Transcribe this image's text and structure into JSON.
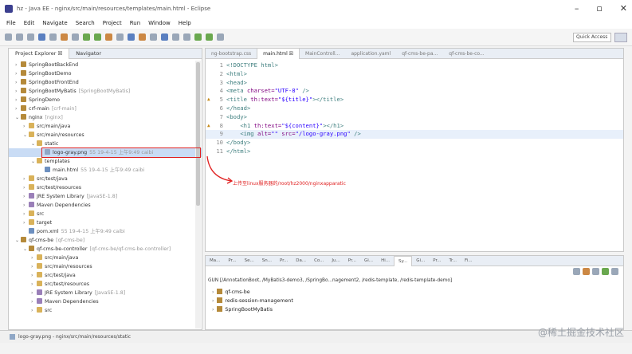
{
  "window": {
    "title": "hz - Java EE - nginx/src/main/resources/templates/main.html - Eclipse",
    "controls": [
      "–",
      "▫",
      "✕"
    ]
  },
  "menu": [
    "File",
    "Edit",
    "Navigate",
    "Search",
    "Project",
    "Run",
    "Window",
    "Help"
  ],
  "toolbar": {
    "quick_access": "Quick Access"
  },
  "left_panel": {
    "tabs": [
      "Project Explorer ☒",
      "Navigator"
    ],
    "tree": [
      {
        "indent": 0,
        "arrow": "›",
        "icon": "proj",
        "label": "SpringBootBackEnd",
        "sub": ""
      },
      {
        "indent": 0,
        "arrow": "›",
        "icon": "proj",
        "label": "SpringBootDemo",
        "sub": ""
      },
      {
        "indent": 0,
        "arrow": "›",
        "icon": "proj",
        "label": "SpringBootFrontEnd",
        "sub": ""
      },
      {
        "indent": 0,
        "arrow": "›",
        "icon": "proj",
        "label": "SpringBootMyBatis",
        "sub": "[SpringBootMyBatis]"
      },
      {
        "indent": 0,
        "arrow": "›",
        "icon": "proj",
        "label": "SpringDemo",
        "sub": ""
      },
      {
        "indent": 0,
        "arrow": "›",
        "icon": "proj",
        "label": "crf-main",
        "sub": "[crf-main]"
      },
      {
        "indent": 0,
        "arrow": "⌄",
        "icon": "proj",
        "label": "nginx",
        "sub": "[nginx]"
      },
      {
        "indent": 1,
        "arrow": "›",
        "icon": "pkg",
        "label": "src/main/java",
        "sub": ""
      },
      {
        "indent": 1,
        "arrow": "⌄",
        "icon": "pkg",
        "label": "src/main/resources",
        "sub": ""
      },
      {
        "indent": 2,
        "arrow": "⌄",
        "icon": "pkg",
        "label": "static",
        "sub": ""
      },
      {
        "indent": 3,
        "arrow": "",
        "icon": "file",
        "label": "logo-gray.png",
        "sub": "55 19-4-15 上午9:49 caibi",
        "selected": true
      },
      {
        "indent": 2,
        "arrow": "⌄",
        "icon": "pkg",
        "label": "templates",
        "sub": ""
      },
      {
        "indent": 3,
        "arrow": "",
        "icon": "xml",
        "label": "main.html",
        "sub": "55 19-4-15 上午9:49 caibi"
      },
      {
        "indent": 1,
        "arrow": "›",
        "icon": "pkg",
        "label": "src/test/java",
        "sub": ""
      },
      {
        "indent": 1,
        "arrow": "›",
        "icon": "pkg",
        "label": "src/test/resources",
        "sub": ""
      },
      {
        "indent": 1,
        "arrow": "›",
        "icon": "lib",
        "label": "JRE System Library",
        "sub": "[JavaSE-1.8]"
      },
      {
        "indent": 1,
        "arrow": "›",
        "icon": "lib",
        "label": "Maven Dependencies",
        "sub": ""
      },
      {
        "indent": 1,
        "arrow": "›",
        "icon": "pkg",
        "label": "src",
        "sub": ""
      },
      {
        "indent": 1,
        "arrow": "›",
        "icon": "pkg",
        "label": "target",
        "sub": ""
      },
      {
        "indent": 1,
        "arrow": "",
        "icon": "xml",
        "label": "pom.xml",
        "sub": "55 19-4-15 上午9:49 caibi"
      },
      {
        "indent": 0,
        "arrow": "⌄",
        "icon": "proj",
        "label": "qf-cms-be",
        "sub": "[qf-cms-be]"
      },
      {
        "indent": 1,
        "arrow": "⌄",
        "icon": "proj",
        "label": "qf-cms-be-controller",
        "sub": "[qf-cms-be/qf-cms-be-controller]"
      },
      {
        "indent": 2,
        "arrow": "›",
        "icon": "pkg",
        "label": "src/main/java",
        "sub": ""
      },
      {
        "indent": 2,
        "arrow": "›",
        "icon": "pkg",
        "label": "src/main/resources",
        "sub": ""
      },
      {
        "indent": 2,
        "arrow": "›",
        "icon": "pkg",
        "label": "src/test/java",
        "sub": ""
      },
      {
        "indent": 2,
        "arrow": "›",
        "icon": "pkg",
        "label": "src/test/resources",
        "sub": ""
      },
      {
        "indent": 2,
        "arrow": "›",
        "icon": "lib",
        "label": "JRE System Library",
        "sub": "[JavaSE-1.8]"
      },
      {
        "indent": 2,
        "arrow": "›",
        "icon": "lib",
        "label": "Maven Dependencies",
        "sub": ""
      },
      {
        "indent": 2,
        "arrow": "›",
        "icon": "pkg",
        "label": "src",
        "sub": ""
      }
    ]
  },
  "editor": {
    "tabs": [
      "ng-bootstrap.css",
      "main.html ☒",
      "MainControll...",
      "application.yaml",
      "qf-cms-be-pa...",
      "qf-cms-be-co..."
    ],
    "lines": [
      {
        "n": "1",
        "parts": [
          [
            "tag",
            "<!DOCTYPE html>"
          ]
        ]
      },
      {
        "n": "2",
        "parts": [
          [
            "tag",
            "<html>"
          ]
        ]
      },
      {
        "n": "3",
        "parts": [
          [
            "tag",
            "<head>"
          ]
        ]
      },
      {
        "n": "4",
        "parts": [
          [
            "tag",
            "<meta "
          ],
          [
            "attr",
            "charset="
          ],
          [
            "str",
            "\"UTF-8\""
          ],
          [
            "tag",
            " />"
          ]
        ]
      },
      {
        "n": "5",
        "marker": "▲",
        "parts": [
          [
            "tag",
            "<title "
          ],
          [
            "attr",
            "th:text="
          ],
          [
            "str",
            "\"${title}\""
          ],
          [
            "tag",
            "></title>"
          ]
        ]
      },
      {
        "n": "6",
        "parts": [
          [
            "tag",
            "</head>"
          ]
        ]
      },
      {
        "n": "7",
        "parts": [
          [
            "tag",
            "<body>"
          ]
        ]
      },
      {
        "n": "8",
        "marker": "▲",
        "parts": [
          [
            "txt",
            "    "
          ],
          [
            "tag",
            "<h1 "
          ],
          [
            "attr",
            "th:text="
          ],
          [
            "str",
            "\"${content}\""
          ],
          [
            "tag",
            "></h1>"
          ]
        ]
      },
      {
        "n": "9",
        "current": true,
        "parts": [
          [
            "txt",
            "    "
          ],
          [
            "tag",
            "<img "
          ],
          [
            "attr",
            "alt="
          ],
          [
            "str",
            "\"\""
          ],
          [
            "attr",
            " src="
          ],
          [
            "str",
            "\"/logo-gray.png\""
          ],
          [
            "tag",
            " />"
          ]
        ]
      },
      {
        "n": "10",
        "parts": [
          [
            "tag",
            "</body>"
          ]
        ]
      },
      {
        "n": "11",
        "parts": [
          [
            "tag",
            "</html>"
          ]
        ]
      }
    ]
  },
  "annotation": {
    "text": "上传至linux服务器的/root/hz2000/nginxapparatic"
  },
  "bottom_panel": {
    "tabs": [
      "Ma...",
      "Pr...",
      "Se...",
      "Sn...",
      "Pr...",
      "Da...",
      "Co...",
      "Ju...",
      "Pr...",
      "Gi...",
      "Hi...",
      "Sy...",
      "Gi...",
      "Pr...",
      "Tr...",
      "Fi..."
    ],
    "active_tab": "Sy...",
    "path": "GUN [/AnnotationBoot, /MyBatis3-demo3, /SpringBo...nagement2, /redis-template, /redis-template-demo]",
    "items": [
      "qf-cms-be",
      "redis-session-management",
      "SpringBootMyBatis"
    ]
  },
  "status": "logo-gray.png - nginx/src/main/resources/static",
  "watermark": "@稀土掘金技术社区"
}
